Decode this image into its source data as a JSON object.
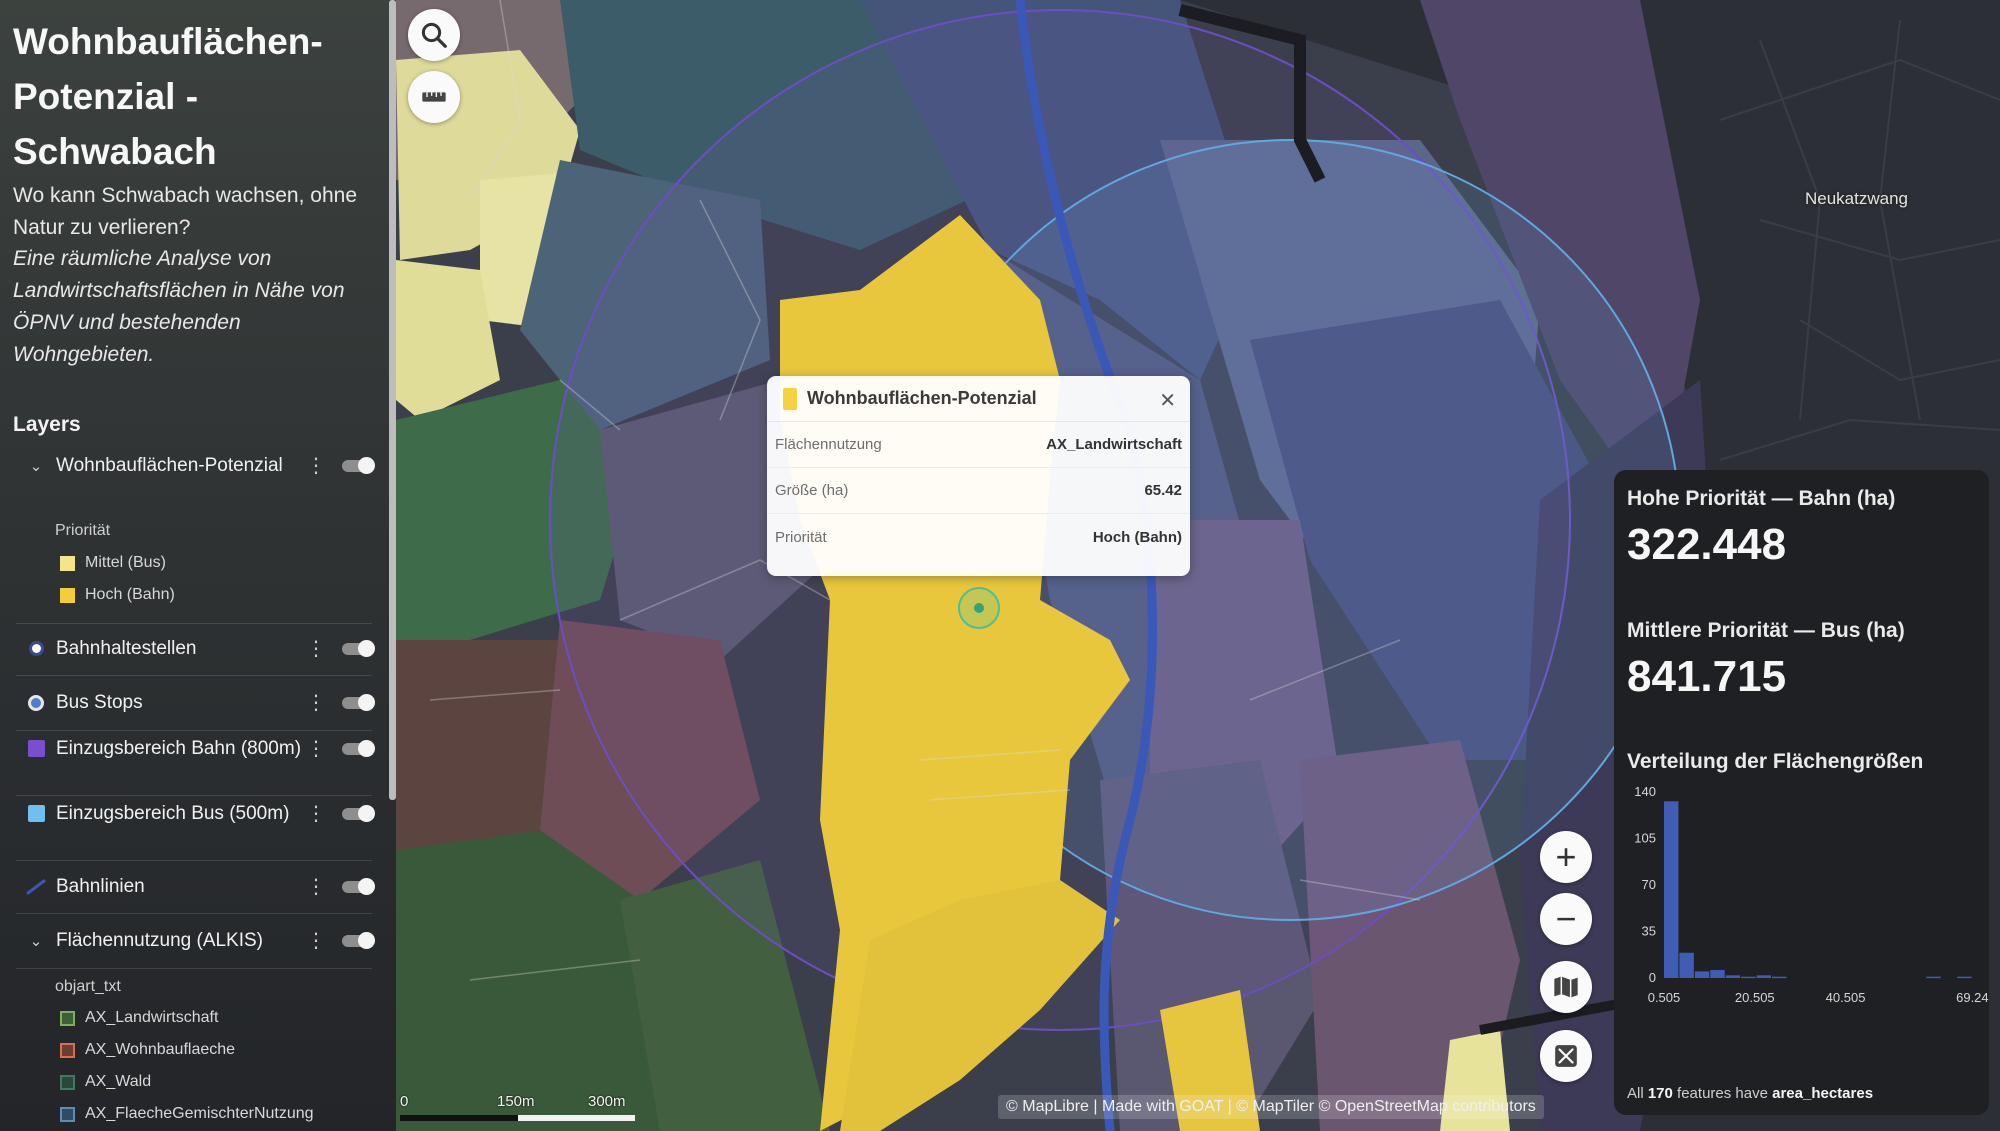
{
  "app": {
    "title": "Wohnbauflächen-Potenzial - Schwabach",
    "subtitle": "Wo kann Schwabach wachsen, ohne Natur zu verlieren?",
    "subtitle_italic": "Eine räumliche Analyse von Landwirtschaftsflächen in Nähe von ÖPNV und bestehenden Wohngebieten."
  },
  "map": {
    "place_label": "Neukatzwang",
    "controls": {
      "search_icon": "search-icon",
      "measure_icon": "ruler-icon"
    },
    "zoom_in": "+",
    "zoom_out": "−",
    "basemap_icon": "map-icon",
    "fullscreen_icon": "fullscreen-icon",
    "attribution": "© MapLibre | Made with GOAT | © MapTiler © OpenStreetMap contributors",
    "scale": {
      "l0": "0",
      "l1": "150m",
      "l2": "300m"
    }
  },
  "layers": {
    "heading": "Layers",
    "items": [
      {
        "name": "Wohnbauflächen-Potenzial",
        "icon": "chevron-down-icon",
        "enabled": true
      },
      {
        "name": "Bahnhaltestellen",
        "icon": "circle-white-icon",
        "enabled": true
      },
      {
        "name": "Bus Stops",
        "icon": "circle-blue-icon",
        "enabled": true
      },
      {
        "name": "Einzugsbereich Bahn (800m)",
        "icon": "square-purple-icon",
        "enabled": true
      },
      {
        "name": "Einzugsbereich Bus (500m)",
        "icon": "square-blue-icon",
        "enabled": true
      },
      {
        "name": "Bahnlinien",
        "icon": "line-icon",
        "enabled": true
      },
      {
        "name": "Flächennutzung (ALKIS)",
        "icon": "chevron-down-icon",
        "enabled": true
      }
    ],
    "potenzial_legend": {
      "title": "Priorität",
      "items": [
        {
          "label": "Mittel (Bus)",
          "color": "#f4e58a"
        },
        {
          "label": "Hoch (Bahn)",
          "color": "#f2cf3a"
        }
      ]
    },
    "alkis_legend": {
      "title": "objart_txt",
      "items": [
        {
          "label": "AX_Landwirtschaft",
          "color": "#7fae5d"
        },
        {
          "label": "AX_Wohnbauflaeche",
          "color": "#d9704a"
        },
        {
          "label": "AX_Wald",
          "color": "#3e7a5d"
        },
        {
          "label": "AX_FlaecheGemischterNutzung",
          "color": "#5a8fb4"
        }
      ]
    }
  },
  "popup": {
    "title": "Wohnbauflächen-Potenzial",
    "rows": [
      {
        "key": "Flächennutzung",
        "value": "AX_Landwirtschaft"
      },
      {
        "key": "Größe (ha)",
        "value": "65.42"
      },
      {
        "key": "Priorität",
        "value": "Hoch (Bahn)"
      }
    ]
  },
  "stats": {
    "high_label": "Hohe Priorität — Bahn (ha)",
    "high_value": "322.448",
    "mid_label": "Mittlere Priorität — Bus (ha)",
    "mid_value": "841.715",
    "hist_title": "Verteilung der Flächengrößen",
    "footer_prefix": "All",
    "footer_count": "170",
    "footer_mid": "features have",
    "footer_field": "area_hectares"
  },
  "chart_data": {
    "type": "bar",
    "title": "Verteilung der Flächengrößen",
    "yticks": [
      "0",
      "35",
      "70",
      "105",
      "140"
    ],
    "ylim": [
      0,
      140
    ],
    "xticks": [
      "0.505",
      "20.505",
      "40.505",
      "69.243"
    ],
    "xlim": [
      0.505,
      69.243
    ],
    "bin_width": 3.4,
    "bins": [
      {
        "x0": 0.505,
        "value": 133
      },
      {
        "x0": 3.9,
        "value": 19
      },
      {
        "x0": 7.3,
        "value": 5
      },
      {
        "x0": 10.7,
        "value": 6
      },
      {
        "x0": 14.1,
        "value": 2
      },
      {
        "x0": 17.5,
        "value": 1
      },
      {
        "x0": 20.9,
        "value": 2
      },
      {
        "x0": 24.3,
        "value": 1
      },
      {
        "x0": 27.7,
        "value": 0
      },
      {
        "x0": 31.1,
        "value": 0
      },
      {
        "x0": 34.5,
        "value": 0
      },
      {
        "x0": 37.9,
        "value": 0
      },
      {
        "x0": 41.3,
        "value": 0
      },
      {
        "x0": 44.7,
        "value": 0
      },
      {
        "x0": 48.1,
        "value": 0
      },
      {
        "x0": 51.5,
        "value": 0
      },
      {
        "x0": 54.9,
        "value": 0
      },
      {
        "x0": 58.3,
        "value": 1
      },
      {
        "x0": 61.7,
        "value": 0
      },
      {
        "x0": 65.1,
        "value": 1
      }
    ],
    "bar_color": "#3f5db3",
    "grid": false
  }
}
